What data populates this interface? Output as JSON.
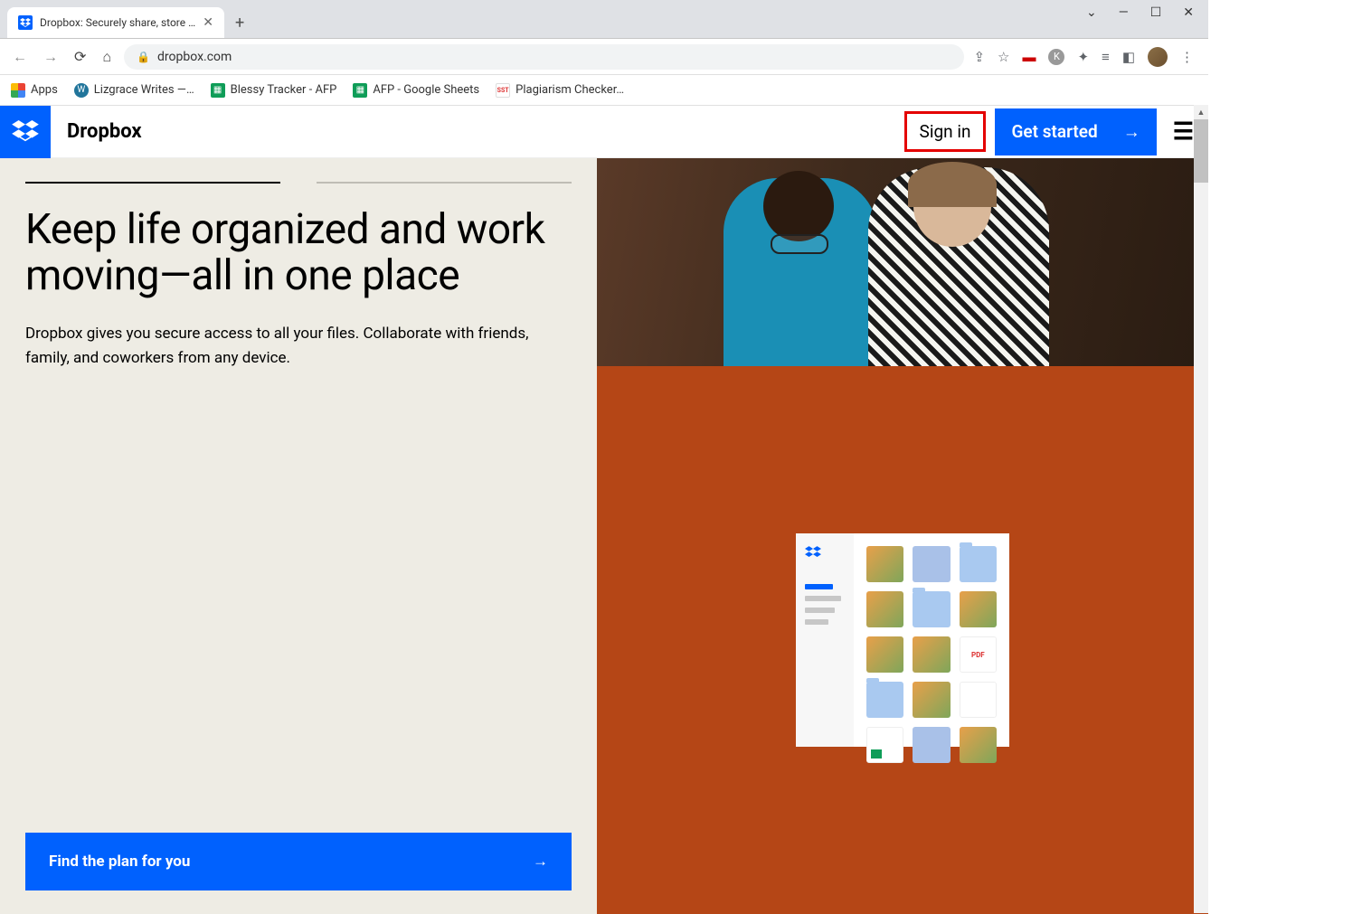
{
  "browser": {
    "tab_title": "Dropbox: Securely share, store an",
    "url": "dropbox.com"
  },
  "bookmarks": {
    "apps": "Apps",
    "lizgrace": "Lizgrace Writes —…",
    "blessy": "Blessy Tracker - AFP",
    "afp": "AFP - Google Sheets",
    "plag": "Plagiarism Checker…"
  },
  "header": {
    "brand": "Dropbox",
    "signin": "Sign in",
    "get_started": "Get started"
  },
  "hero": {
    "title": "Keep life organized and work moving—all in one place",
    "subtitle": "Dropbox gives you secure access to all your files. Collaborate with friends, family, and coworkers from any device.",
    "cta": "Find the plan for you"
  },
  "file_tile_pdf": "PDF"
}
